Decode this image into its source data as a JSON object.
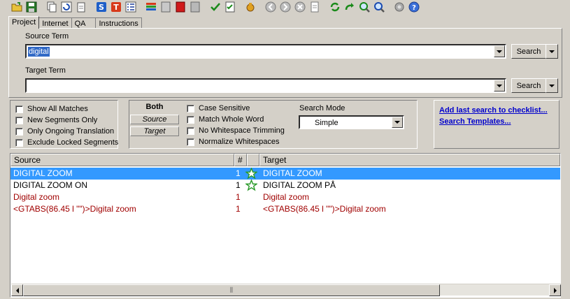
{
  "toolbar": {
    "icons": [
      "open-folder-icon",
      "save-icon",
      "copy-icon",
      "refresh-icon",
      "clipboard-icon",
      "s-icon",
      "t-icon",
      "list-icon",
      "bars-icon",
      "gray-square-icon",
      "red-square-icon",
      "gray-square-icon",
      "check-icon",
      "check-list-icon",
      "coin-icon",
      "back-icon",
      "forward-icon",
      "stop-icon",
      "page-icon",
      "cycle-icon",
      "redo-icon",
      "zoom-in-icon",
      "zoom-icon",
      "gear-icon",
      "help-icon"
    ]
  },
  "tabs": [
    {
      "label": "Project"
    },
    {
      "label": "Internet"
    },
    {
      "label": "QA"
    },
    {
      "label": "Instructions"
    }
  ],
  "source": {
    "label": "Source Term",
    "value": "digital",
    "search_label": "Search"
  },
  "target": {
    "label": "Target Term",
    "value": "",
    "search_label": "Search"
  },
  "options_left": [
    {
      "label": "Show All Matches"
    },
    {
      "label": "New Segments Only"
    },
    {
      "label": "Only Ongoing Translation"
    },
    {
      "label": "Exclude Locked Segments"
    }
  ],
  "mode_buttons": {
    "both": "Both",
    "source": "Source",
    "target": "Target"
  },
  "options_mid": [
    {
      "label": "Case Sensitive"
    },
    {
      "label": "Match Whole Word"
    },
    {
      "label": "No Whitespace Trimming"
    },
    {
      "label": "Normalize Whitespaces"
    }
  ],
  "search_mode": {
    "label": "Search Mode",
    "value": "Simple"
  },
  "links": {
    "add_last": "Add last search to checklist...",
    "templates": "Search Templates..."
  },
  "table": {
    "columns": [
      "Source",
      "#",
      "Target"
    ],
    "rows": [
      {
        "source": "DIGITAL ZOOM",
        "count": "1",
        "target": "DIGITAL ZOOM",
        "star": true,
        "selected": true
      },
      {
        "source": "DIGITAL ZOOM ON",
        "count": "1",
        "target": "DIGITAL ZOOM PÅ",
        "star": true,
        "selected": false
      },
      {
        "source": "Digital zoom",
        "count": "1",
        "target": "Digital zoom",
        "star": false,
        "selected": false
      },
      {
        "source": "<GTABS(86.45 l \"\")>Digital zoom",
        "count": "1",
        "target": "<GTABS(86.45 l \"\")>Digital zoom",
        "star": false,
        "selected": false
      }
    ]
  },
  "colors": {
    "selection": "#3399ff",
    "red_text": "#a00000",
    "link": "#0000cc"
  }
}
